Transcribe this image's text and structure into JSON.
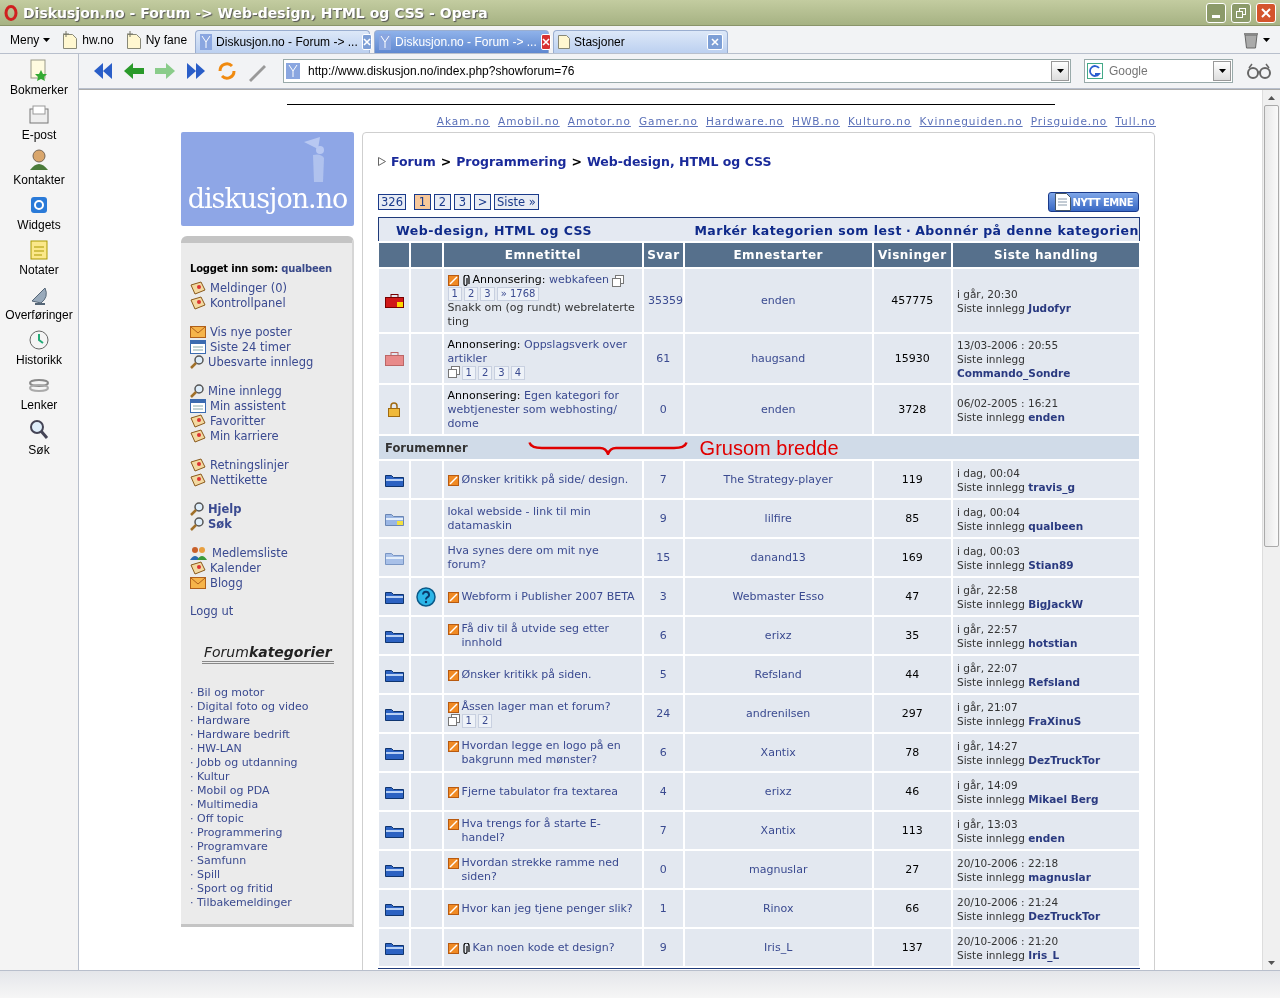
{
  "window": {
    "title": "Diskusjon.no - Forum -> Web-design, HTML og CSS - Opera"
  },
  "menu_button": "Meny",
  "bookmarks_bar": [
    {
      "label": "hw.no"
    },
    {
      "label": "Ny fane"
    }
  ],
  "tabs": [
    {
      "label": "Diskusjon.no - Forum -> ...",
      "selected": false
    },
    {
      "label": "Diskusjon.no - Forum -> ...",
      "selected": true
    },
    {
      "label": "Stasjoner",
      "selected": false
    }
  ],
  "panel": [
    {
      "kind": "bookmark",
      "label": "Bokmerker"
    },
    {
      "kind": "mail",
      "label": "E-post"
    },
    {
      "kind": "contact",
      "label": "Kontakter"
    },
    {
      "kind": "widget",
      "label": "Widgets"
    },
    {
      "kind": "notes",
      "label": "Notater"
    },
    {
      "kind": "transfer",
      "label": "Overføringer"
    },
    {
      "kind": "history",
      "label": "Historikk"
    },
    {
      "kind": "links",
      "label": "Lenker"
    },
    {
      "kind": "search",
      "label": "Søk"
    }
  ],
  "address": {
    "value": "http://www.diskusjon.no/index.php?showforum=76"
  },
  "search": {
    "placeholder": "Google"
  },
  "site_links": [
    "Akam.no",
    "Amobil.no",
    "Amotor.no",
    "Gamer.no",
    "Hardware.no",
    "HWB.no",
    "Kulturo.no",
    "Kvinneguiden.no",
    "Prisguide.no",
    "Tull.no"
  ],
  "logo": {
    "text": "diskusjon.no"
  },
  "user_menu": {
    "logged_in_label": "Logget inn som:",
    "username": "qualbeen",
    "groups": [
      {
        "items": [
          {
            "kind": "scroll",
            "label": "Meldinger (0)",
            "bold": false
          },
          {
            "kind": "scroll",
            "label": "Kontrollpanel",
            "bold": false
          }
        ]
      },
      {
        "items": [
          {
            "kind": "envelope",
            "label": "Vis nye poster",
            "bold": false
          },
          {
            "kind": "calendar",
            "label": "Siste 24 timer",
            "bold": false
          },
          {
            "kind": "magnifier",
            "label": "Ubesvarte innlegg",
            "bold": false
          }
        ]
      },
      {
        "items": [
          {
            "kind": "magnifier",
            "label": "Mine innlegg",
            "bold": false
          },
          {
            "kind": "calendar",
            "label": "Min assistent",
            "bold": false
          },
          {
            "kind": "scroll",
            "label": "Favoritter",
            "bold": false
          },
          {
            "kind": "scroll",
            "label": "Min karriere",
            "bold": false
          }
        ]
      },
      {
        "items": [
          {
            "kind": "scroll",
            "label": "Retningslinjer",
            "bold": false
          },
          {
            "kind": "scroll",
            "label": "Nettikette",
            "bold": false
          }
        ]
      },
      {
        "items": [
          {
            "kind": "magnifier",
            "label": "Hjelp",
            "bold": true
          },
          {
            "kind": "magnifier",
            "label": "Søk",
            "bold": true
          }
        ]
      },
      {
        "items": [
          {
            "kind": "people",
            "label": "Medlemsliste",
            "bold": false
          },
          {
            "kind": "scroll",
            "label": "Kalender",
            "bold": false
          },
          {
            "kind": "envelope",
            "label": "Blogg",
            "bold": false
          }
        ]
      }
    ],
    "logout": "Logg ut"
  },
  "categories": {
    "title": "Forum**kategorier**",
    "items": [
      "· Bil og motor",
      "· Digital foto og video",
      "· Hardware",
      "· Hardware bedrift",
      "· HW-LAN",
      "· Jobb og utdanning",
      "· Kultur",
      "· Mobil og PDA",
      "· Multimedia",
      "· Off topic",
      "· Programmering",
      "· Programvare",
      "· Samfunn",
      "· Spill",
      "· Sport og fritid",
      "· Tilbakemeldinger"
    ]
  },
  "breadcrumb": [
    {
      "kind": "link",
      "text": "Forum"
    },
    {
      "kind": "sep",
      "text": ">"
    },
    {
      "kind": "link",
      "text": "Programmering"
    },
    {
      "kind": "sep",
      "text": ">"
    },
    {
      "kind": "link",
      "text": "Web-design, HTML og CSS"
    }
  ],
  "pagination": {
    "count": "326",
    "pages": [
      {
        "label": "1",
        "selected": true
      },
      {
        "label": "2",
        "selected": false
      },
      {
        "label": "3",
        "selected": false
      }
    ],
    "next": ">",
    "last": "Siste »"
  },
  "new_topic_button": "NYTT EMNE",
  "table": {
    "title": "Web-design, HTML og CSS",
    "actions": [
      "Markér kategorien som lest",
      "Abonnér på denne kategorien"
    ],
    "action_separator": "·",
    "columns": [
      "Emnetittel",
      "Svar",
      "Emnestarter",
      "Visninger",
      "Siste handling"
    ],
    "pinned": [
      {
        "kind": "hot_briefcase",
        "question": false,
        "hot": true,
        "attachment": true,
        "prefix": "Annonsering:",
        "title": "webkafeen",
        "pages": [
          "1",
          "2",
          "3",
          "» 1768"
        ],
        "description": "Snakk om (og rundt) webrelaterte ting",
        "replies": "35359",
        "starter": "enden",
        "views": "457775",
        "last_time": "i går, 20:30",
        "last_label": "Siste innlegg",
        "last_user": "Judofyr"
      },
      {
        "kind": "briefcase",
        "question": false,
        "hot": false,
        "attachment": false,
        "prefix": "Annonsering:",
        "title": "Oppslagsverk over artikler",
        "pages": [
          "1",
          "2",
          "3",
          "4"
        ],
        "replies": "61",
        "starter": "haugsand",
        "views": "15930",
        "last_time": "13/03-2006 : 20:55",
        "last_label": "Siste innlegg",
        "last_user": "Commando_Sondre"
      },
      {
        "kind": "lock",
        "question": false,
        "hot": false,
        "attachment": false,
        "prefix": "Annonsering:",
        "title": "Egen kategori for webtjenester som webhosting/ dome",
        "replies": "0",
        "starter": "enden",
        "views": "3728",
        "last_time": "06/02-2005 : 16:21",
        "last_label": "Siste innlegg",
        "last_user": "enden"
      }
    ],
    "section": "Forumemner",
    "topics": [
      {
        "kind": "folder",
        "question": false,
        "hot": true,
        "attachment": false,
        "title": "Ønsker kritikk på side/ design.",
        "replies": "7",
        "starter": "The Strategy-player",
        "views": "119",
        "last_time": "i dag, 00:04",
        "last_label": "Siste innlegg",
        "last_user": "travis_g"
      },
      {
        "kind": "folder_new",
        "question": false,
        "hot": false,
        "attachment": false,
        "title": "lokal webside - link til min datamaskin",
        "replies": "9",
        "starter": "lilfire",
        "views": "85",
        "last_time": "i dag, 00:04",
        "last_label": "Siste innlegg",
        "last_user": "qualbeen"
      },
      {
        "kind": "folder_faded",
        "question": false,
        "hot": false,
        "attachment": false,
        "title": "Hva synes dere om mit nye forum?",
        "replies": "15",
        "starter": "danand13",
        "views": "169",
        "last_time": "i dag, 00:03",
        "last_label": "Siste innlegg",
        "last_user": "Stian89"
      },
      {
        "kind": "folder",
        "question": true,
        "hot": true,
        "attachment": false,
        "title": "Webform i Publisher 2007 BETA",
        "replies": "3",
        "starter": "Webmaster Esso",
        "views": "47",
        "last_time": "i går, 22:58",
        "last_label": "Siste innlegg",
        "last_user": "BigJackW"
      },
      {
        "kind": "folder",
        "question": false,
        "hot": true,
        "attachment": false,
        "title": "Få div til å utvide seg etter innhold",
        "replies": "6",
        "starter": "erixz",
        "views": "35",
        "last_time": "i går, 22:57",
        "last_label": "Siste innlegg",
        "last_user": "hotstian"
      },
      {
        "kind": "folder",
        "question": false,
        "hot": true,
        "attachment": false,
        "title": "Ønsker kritikk på siden.",
        "replies": "5",
        "starter": "Refsland",
        "views": "44",
        "last_time": "i går, 22:07",
        "last_label": "Siste innlegg",
        "last_user": "Refsland"
      },
      {
        "kind": "folder",
        "question": false,
        "hot": true,
        "attachment": false,
        "title": "Åssen lager man et forum?",
        "pages": [
          "1",
          "2"
        ],
        "replies": "24",
        "starter": "andrenilsen",
        "views": "297",
        "last_time": "i går, 21:07",
        "last_label": "Siste innlegg",
        "last_user": "FraXinuS"
      },
      {
        "kind": "folder",
        "question": false,
        "hot": true,
        "attachment": false,
        "title": "Hvordan legge en logo på en bakgrunn med mønster?",
        "replies": "6",
        "starter": "Xantix",
        "views": "78",
        "last_time": "i går, 14:27",
        "last_label": "Siste innlegg",
        "last_user": "DezTruckTor"
      },
      {
        "kind": "folder",
        "question": false,
        "hot": true,
        "attachment": false,
        "title": "Fjerne tabulator fra textarea",
        "replies": "4",
        "starter": "erixz",
        "views": "46",
        "last_time": "i går, 14:09",
        "last_label": "Siste innlegg",
        "last_user": "Mikael Berg"
      },
      {
        "kind": "folder",
        "question": false,
        "hot": true,
        "attachment": false,
        "title": "Hva trengs for å starte E-handel?",
        "replies": "7",
        "starter": "Xantix",
        "views": "113",
        "last_time": "i går, 13:03",
        "last_label": "Siste innlegg",
        "last_user": "enden"
      },
      {
        "kind": "folder",
        "question": false,
        "hot": true,
        "attachment": false,
        "title": "Hvordan strekke ramme ned siden?",
        "replies": "0",
        "starter": "magnuslar",
        "views": "27",
        "last_time": "20/10-2006 : 22:18",
        "last_label": "Siste innlegg",
        "last_user": "magnuslar"
      },
      {
        "kind": "folder",
        "question": false,
        "hot": true,
        "attachment": false,
        "title": "Hvor kan jeg tjene penger slik?",
        "replies": "1",
        "starter": "Rinox",
        "views": "66",
        "last_time": "20/10-2006 : 21:24",
        "last_label": "Siste innlegg",
        "last_user": "DezTruckTor"
      },
      {
        "kind": "folder",
        "question": false,
        "hot": true,
        "attachment": true,
        "title": "Kan noen kode et design?",
        "replies": "9",
        "starter": "Iris_L",
        "views": "137",
        "last_time": "20/10-2006 : 21:20",
        "last_label": "Siste innlegg",
        "last_user": "Iris_L"
      }
    ]
  },
  "annotation": {
    "text": "Grusom bredde"
  }
}
